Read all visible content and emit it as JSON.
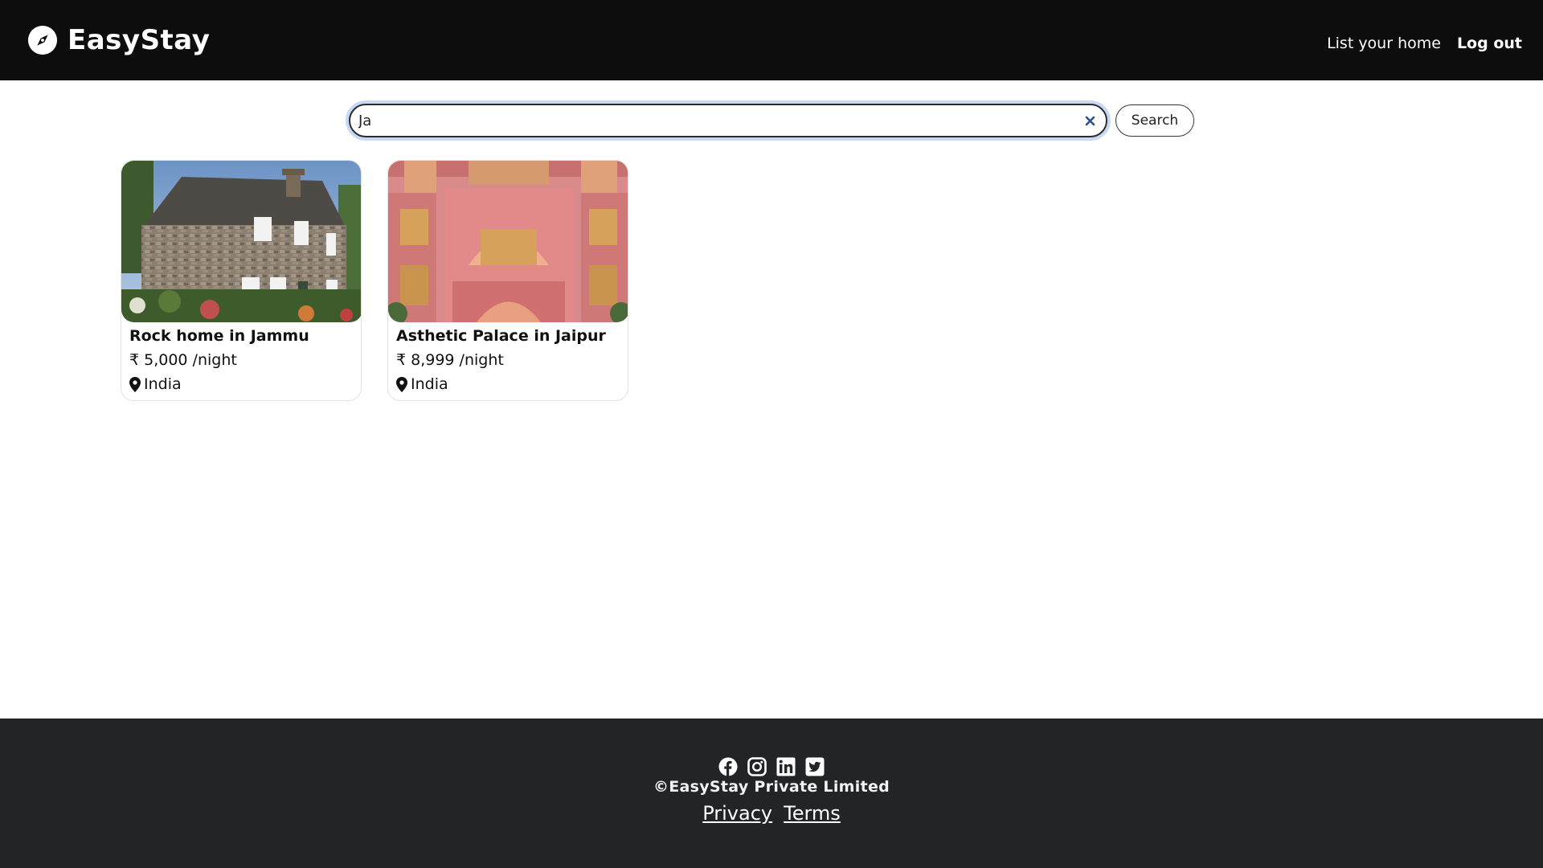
{
  "navbar": {
    "brand": "EasyStay",
    "brand_icon": "compass-icon",
    "links": [
      {
        "label": "List your home"
      },
      {
        "label": "Log out"
      }
    ]
  },
  "search": {
    "value": "Ja",
    "placeholder": "",
    "clear_icon": "close-icon",
    "button_label": "Search"
  },
  "listings": [
    {
      "title": "Rock home in Jammu",
      "price": "₹ 5,000 /night",
      "location": "India",
      "image": "stone-cottage-photo"
    },
    {
      "title": "Asthetic Palace in Jaipur",
      "price": "₹ 8,999 /night",
      "location": "India",
      "image": "pink-palace-photo"
    }
  ],
  "footer": {
    "socials": [
      "facebook-icon",
      "instagram-icon",
      "linkedin-icon",
      "twitter-icon"
    ],
    "copyright": "©EasyStay Private Limited",
    "links": [
      {
        "label": "Privacy"
      },
      {
        "label": "Terms"
      }
    ]
  },
  "colors": {
    "navbar_bg": "#0d0d0d",
    "footer_bg": "#222426",
    "focus_ring": "#c7d9f5"
  }
}
